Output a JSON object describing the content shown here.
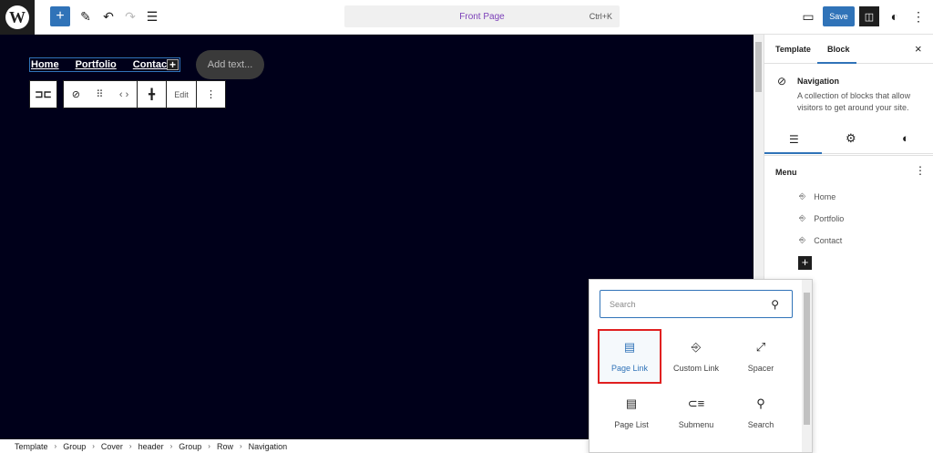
{
  "topbar": {
    "title": "Front Page",
    "shortcut": "Ctrl+K",
    "save": "Save"
  },
  "canvas": {
    "nav_items": [
      "Home",
      "Portfolio",
      "Contact"
    ],
    "add_text": "Add text...",
    "toolbar_edit": "Edit"
  },
  "sidebar": {
    "tabs": [
      "Template",
      "Block"
    ],
    "block_title": "Navigation",
    "block_desc": "A collection of blocks that allow visitors to get around your site.",
    "menu_label": "Menu",
    "menu_items": [
      "Home",
      "Portfolio",
      "Contact"
    ]
  },
  "inserter": {
    "search_placeholder": "Search",
    "blocks": [
      "Page Link",
      "Custom Link",
      "Spacer",
      "Page List",
      "Submenu",
      "Search"
    ]
  },
  "breadcrumbs": [
    "Template",
    "Group",
    "Cover",
    "header",
    "Group",
    "Row",
    "Navigation"
  ],
  "colors": {
    "accent": "#3073b8",
    "canvas": "#00001a",
    "highlight": "#e02020"
  }
}
